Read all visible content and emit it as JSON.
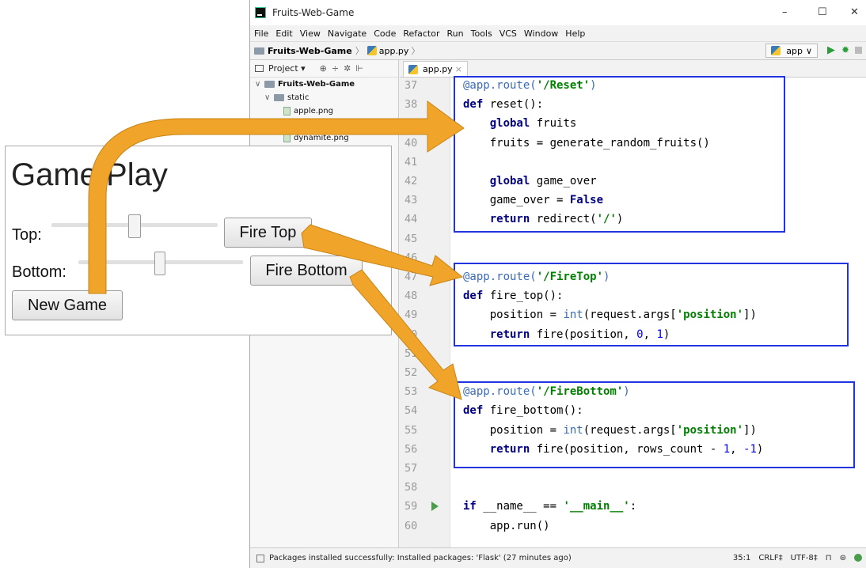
{
  "window": {
    "title": "Fruits-Web-Game",
    "minimize": "–",
    "maximize": "☐",
    "close": "✕"
  },
  "menu": [
    "File",
    "Edit",
    "View",
    "Navigate",
    "Code",
    "Refactor",
    "Run",
    "Tools",
    "VCS",
    "Window",
    "Help"
  ],
  "breadcrumb": {
    "project": "Fruits-Web-Game",
    "sep": "〉",
    "file": "app.py",
    "sep2": "〉"
  },
  "run_config": {
    "name": "app",
    "arrow": "∨"
  },
  "project_pane": {
    "header": "Project ▾",
    "tree": [
      {
        "label": "Fruits-Web-Game",
        "indent": 0,
        "type": "folder"
      },
      {
        "label": "static",
        "indent": 1,
        "type": "folder"
      },
      {
        "label": "apple.png",
        "indent": 2,
        "type": "file"
      },
      {
        "label": "dynamite.png",
        "indent": 2,
        "type": "file"
      }
    ]
  },
  "editor": {
    "tab": "app.py",
    "tab_close": "×"
  },
  "lines": [
    {
      "n": "37",
      "html": "<span class='dec'>@app.route(</span><span class='str'>'/Reset'</span><span class='dec'>)</span>"
    },
    {
      "n": "38",
      "html": "<span class='kw'>def</span> reset():"
    },
    {
      "n": "39",
      "html": "    <span class='kw'>global</span> fruits"
    },
    {
      "n": "40",
      "html": "    fruits = generate_random_fruits()"
    },
    {
      "n": "41",
      "html": ""
    },
    {
      "n": "42",
      "html": "    <span class='kw'>global</span> game_over"
    },
    {
      "n": "43",
      "html": "    game_over = <span class='kw'>False</span>"
    },
    {
      "n": "44",
      "html": "    <span class='kw'>return</span> redirect(<span class='str'>'/'</span>)"
    },
    {
      "n": "45",
      "html": ""
    },
    {
      "n": "46",
      "html": ""
    },
    {
      "n": "47",
      "html": "<span class='dec'>@app.route(</span><span class='str'>'/FireTop'</span><span class='dec'>)</span>"
    },
    {
      "n": "48",
      "html": "<span class='kw'>def</span> fire_top():"
    },
    {
      "n": "49",
      "html": "    position = <span class='dec'>int</span>(request.args[<span class='str'>'position'</span>])"
    },
    {
      "n": "50",
      "html": "    <span class='kw'>return</span> fire(position, <span class='num'>0</span>, <span class='num'>1</span>)"
    },
    {
      "n": "51",
      "html": ""
    },
    {
      "n": "52",
      "html": ""
    },
    {
      "n": "53",
      "html": "<span class='dec'>@app.route(</span><span class='str'>'/FireBottom'</span><span class='dec'>)</span>"
    },
    {
      "n": "54",
      "html": "<span class='kw'>def</span> fire_bottom():"
    },
    {
      "n": "55",
      "html": "    position = <span class='dec'>int</span>(request.args[<span class='str'>'position'</span>])"
    },
    {
      "n": "56",
      "html": "    <span class='kw'>return</span> fire(position, rows_count - <span class='num'>1</span>, <span class='num'>-1</span>)"
    },
    {
      "n": "57",
      "html": ""
    },
    {
      "n": "58",
      "html": ""
    },
    {
      "n": "59",
      "html": "<span class='kw'>if</span> __name__ == <span class='str'>'__main__'</span>:"
    },
    {
      "n": "60",
      "html": "    app.run()"
    }
  ],
  "status": {
    "message": "Packages installed successfully: Installed packages: 'Flask' (27 minutes ago)",
    "position": "35:1",
    "line_sep": "CRLF‡",
    "encoding": "UTF-8‡"
  },
  "game": {
    "title": "Game Play",
    "top_label": "Top:",
    "bottom_label": "Bottom:",
    "fire_top": "Fire Top",
    "fire_bottom": "Fire Bottom",
    "new_game": "New Game",
    "top_slider_value": 0.5,
    "bottom_slider_value": 0.5
  },
  "colors": {
    "arrow": "#f0a42a",
    "box": "#2134e0",
    "keyword": "#000080",
    "string": "#008000"
  }
}
